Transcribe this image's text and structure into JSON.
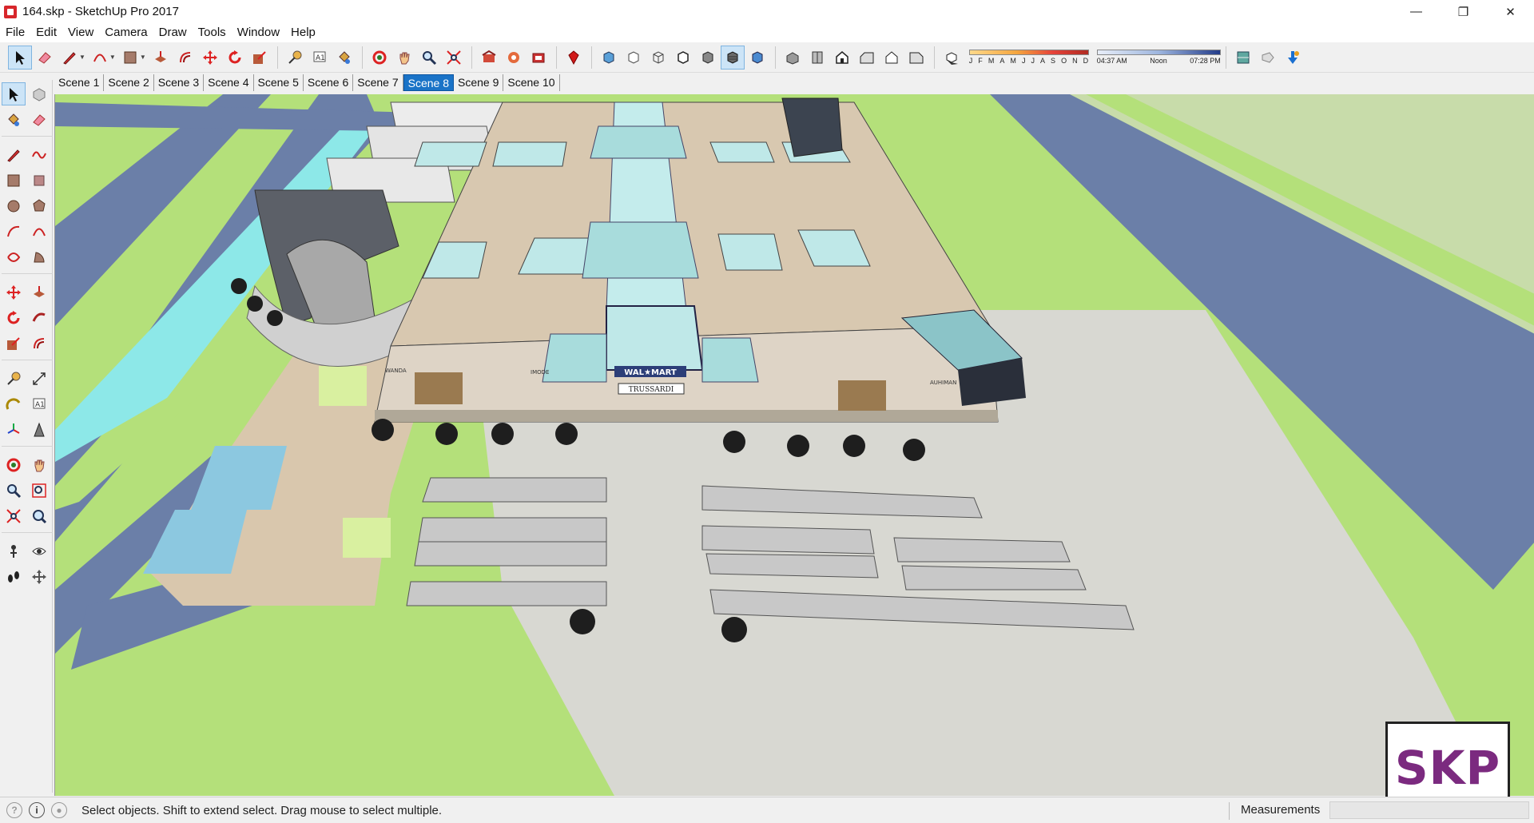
{
  "window": {
    "title": "164.skp - SketchUp Pro 2017",
    "minimize": "—",
    "maximize": "❐",
    "close": "✕"
  },
  "menu": [
    "File",
    "Edit",
    "View",
    "Camera",
    "Draw",
    "Tools",
    "Window",
    "Help"
  ],
  "toolbar": {
    "shadow_months": [
      "J",
      "F",
      "M",
      "A",
      "M",
      "J",
      "J",
      "A",
      "S",
      "O",
      "N",
      "D"
    ],
    "time_start": "04:37 AM",
    "time_noon": "Noon",
    "time_end": "07:28 PM"
  },
  "scenes": [
    "Scene 1",
    "Scene 2",
    "Scene 3",
    "Scene 4",
    "Scene 5",
    "Scene 6",
    "Scene 7",
    "Scene 8",
    "Scene 9",
    "Scene 10"
  ],
  "selected_scene": "Scene 8",
  "model": {
    "store_main_sign": "WAL★MART",
    "store_sub_sign": "TRUSSARDI",
    "left_sign": "WANDA",
    "mid_sign": "IMODE",
    "right_sign": "AUHIMAN"
  },
  "watermark": "SKP",
  "status": {
    "message": "Select objects. Shift to extend select. Drag mouse to select multiple.",
    "measurements_label": "Measurements",
    "measurements_value": ""
  },
  "colors": {
    "grass": "#b4e07a",
    "road": "#6b7fa8",
    "water": "#8de8e8",
    "roof": "#d8c8b0",
    "glass": "#bfe8e8",
    "selected_tab": "#1a73c7",
    "logo_purple": "#7b2a7f"
  }
}
